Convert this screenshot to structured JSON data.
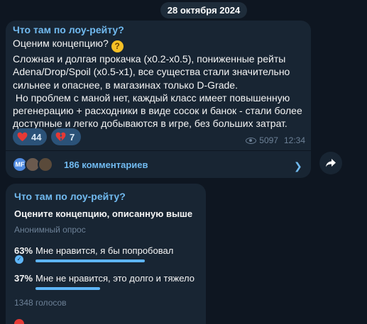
{
  "date_separator": "28 октября 2024",
  "post": {
    "channel": "Что там по лоу-рейту?",
    "text_lines": [
      "Оценим концепцию?",
      "Сложная и долгая прокачка (x0.2-x0.5), пониженные рейты Adena/Drop/Spoil (x0.5-x1), все существа стали значительно сильнее и опаснее, в магазинах только D-Grade.",
      " Но проблем с маной нет, каждый класс имеет повышенную регенерацию + расходники в виде сосок и банок - стали более доступные и легко добываются в игре, без больших затрат."
    ],
    "emoji_icon": "thinking-face-icon",
    "reactions": [
      {
        "icon": "red-heart-icon",
        "count": "44"
      },
      {
        "icon": "broken-heart-icon",
        "count": "7"
      }
    ],
    "views": "5097",
    "time": "12:34",
    "comments": {
      "avatar_initials": "MF",
      "label": "186 комментариев"
    }
  },
  "poll": {
    "channel": "Что там по лоу-рейту?",
    "question": "Оцените концепцию, описанную выше",
    "type": "Анонимный опрос",
    "options": [
      {
        "percent": "63%",
        "text": "Мне нравится, я бы попробовал",
        "fraction": 0.63,
        "chosen": true
      },
      {
        "percent": "37%",
        "text": "Мне не нравится, это долго и тяжело",
        "fraction": 0.37,
        "chosen": false
      }
    ],
    "votes": "1348 голосов"
  },
  "colors": {
    "background": "#0e1621",
    "bubble": "#182533",
    "accent": "#71baf0",
    "poll_bar": "#5eb5f7",
    "muted": "#6d8197",
    "reaction": "#2b5278"
  }
}
